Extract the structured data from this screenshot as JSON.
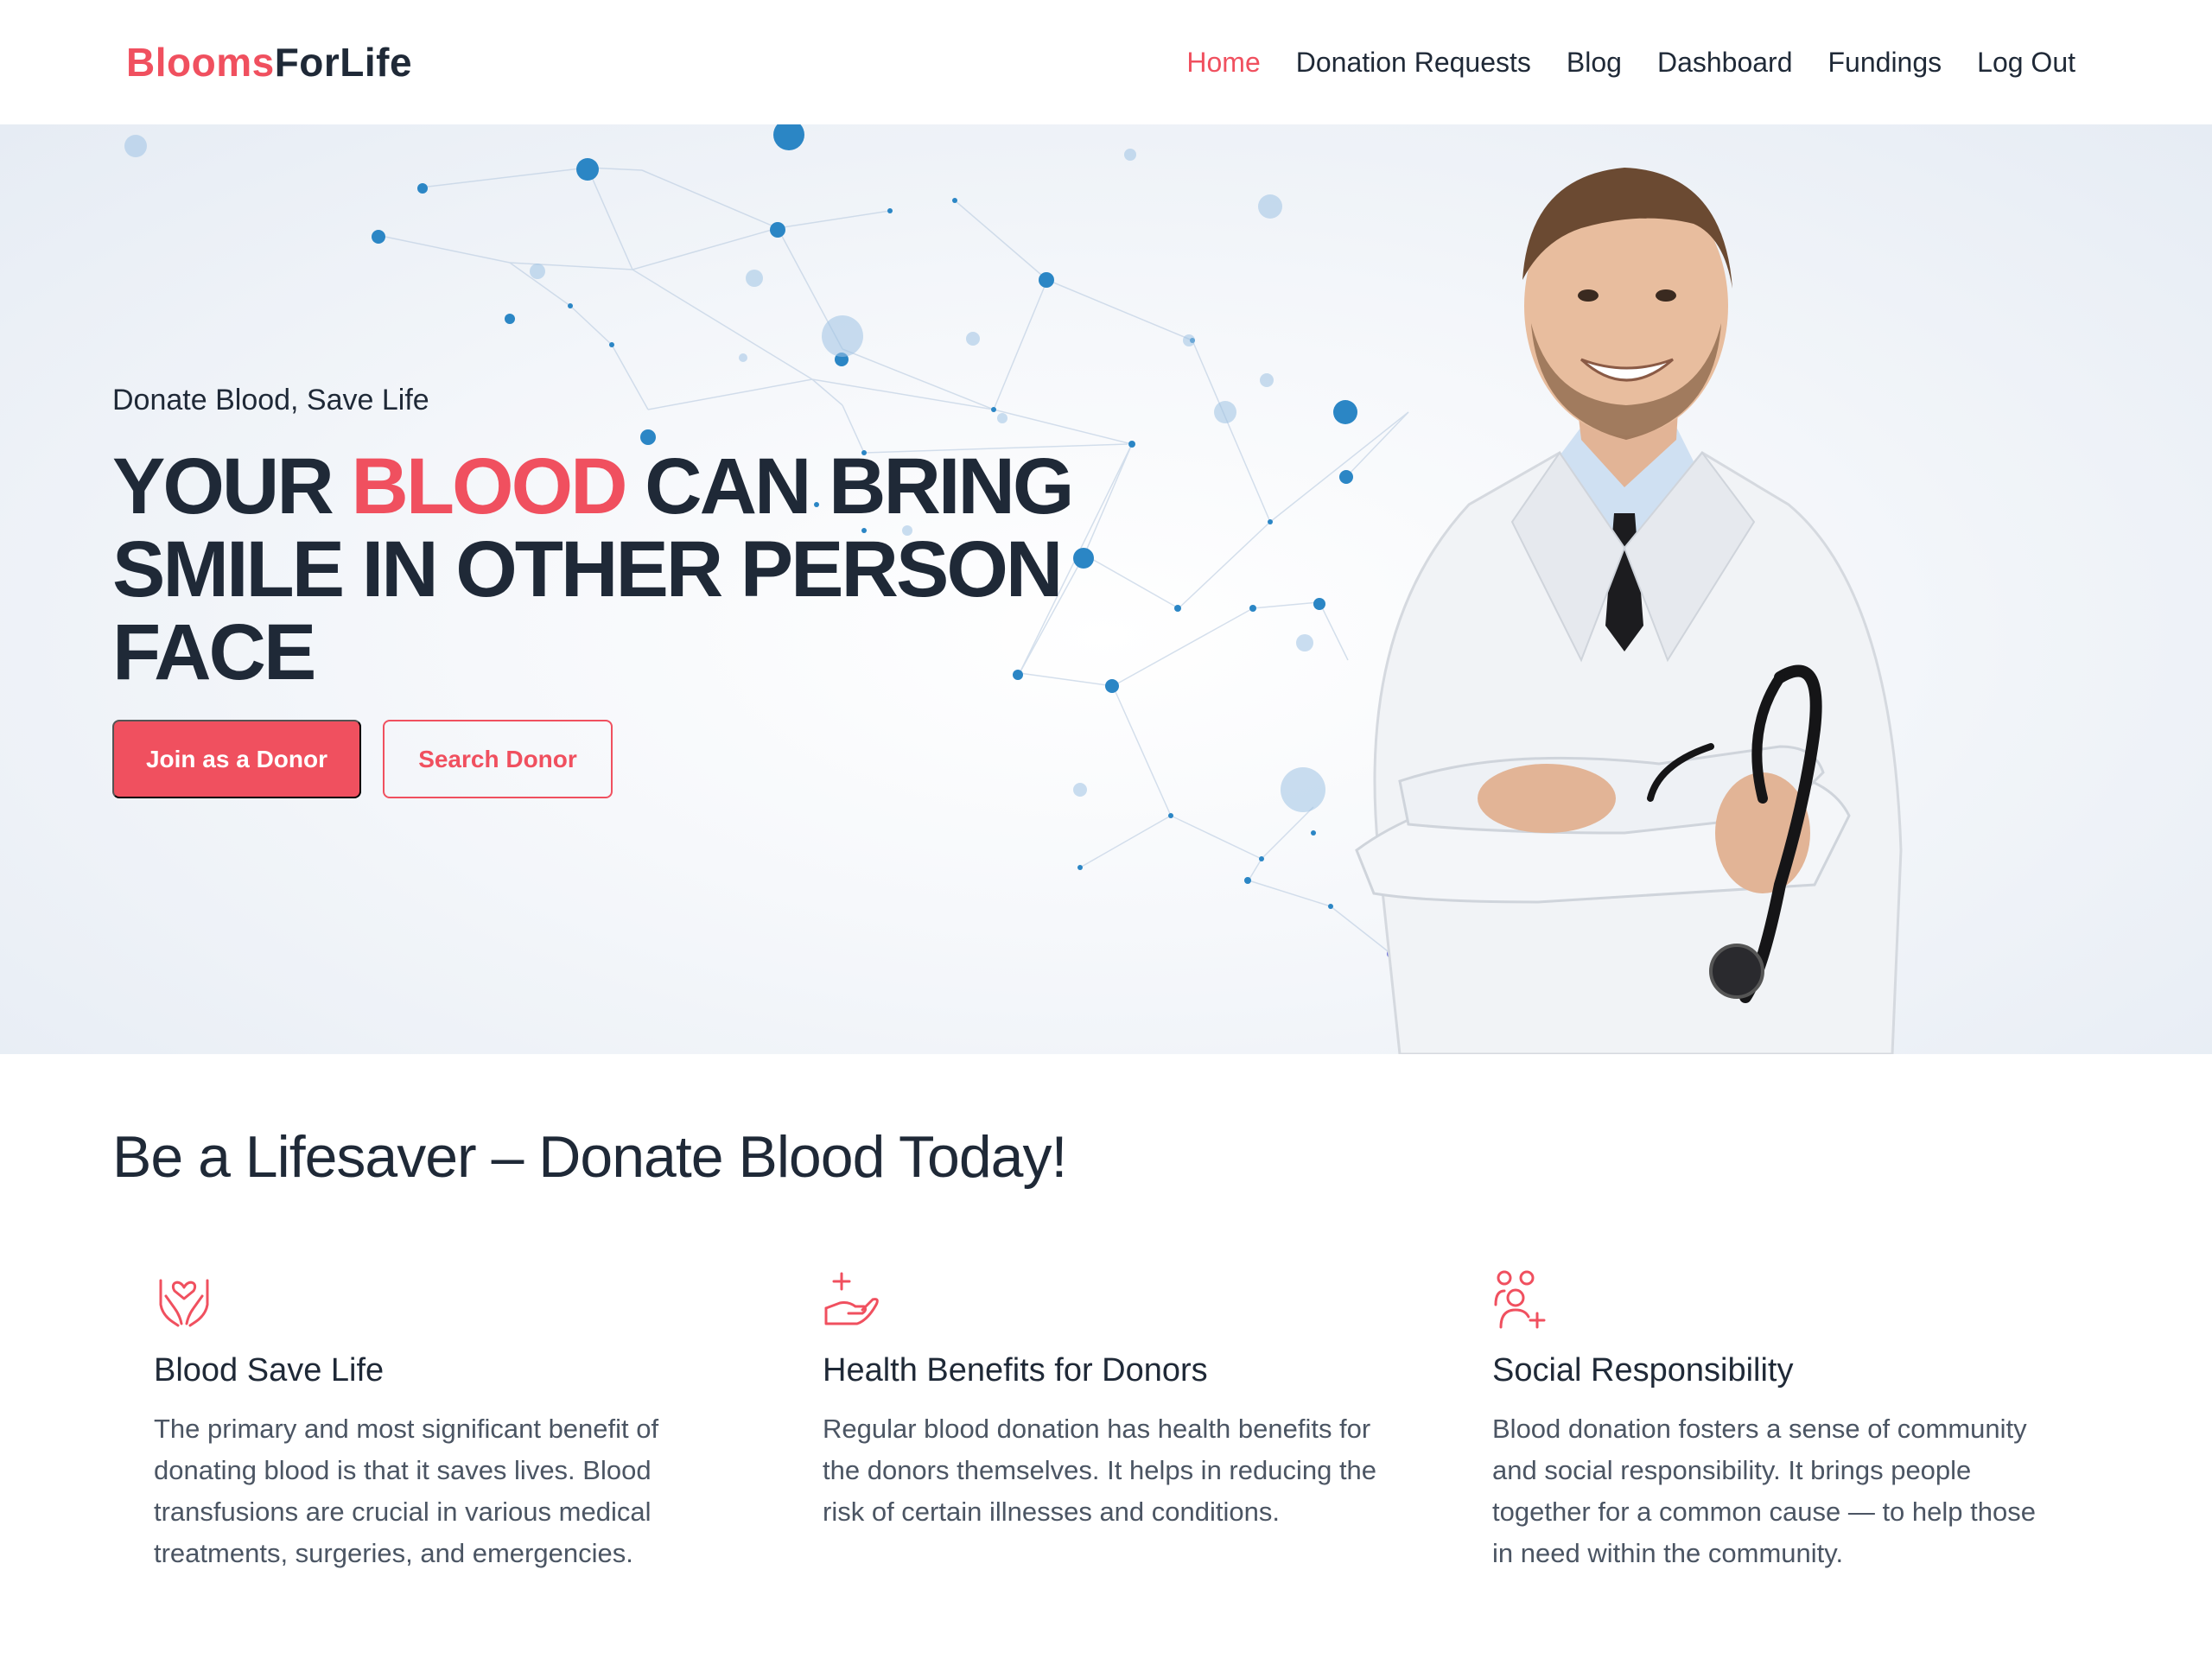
{
  "brand": {
    "part1": "Blooms",
    "part2": "ForLife"
  },
  "nav": {
    "items": [
      {
        "label": "Home",
        "active": true
      },
      {
        "label": "Donation Requests",
        "active": false
      },
      {
        "label": "Blog",
        "active": false
      },
      {
        "label": "Dashboard",
        "active": false
      },
      {
        "label": "Fundings",
        "active": false
      },
      {
        "label": "Log Out",
        "active": false
      }
    ]
  },
  "hero": {
    "eyebrow": "Donate Blood, Save Life",
    "title_part1": "YOUR ",
    "title_accent": "BLOOD",
    "title_part2": " CAN BRING SMILE IN OTHER PERSON FACE",
    "primary_button": "Join as a Donor",
    "secondary_button": "Search Donor"
  },
  "section": {
    "title": "Be a Lifesaver – Donate Blood Today!",
    "features": [
      {
        "icon": "heart-hands-icon",
        "title": "Blood Save Life",
        "text": "The primary and most significant benefit of donating blood is that it saves lives. Blood transfusions are crucial in various medical treatments, surgeries, and emergencies."
      },
      {
        "icon": "hand-plus-icon",
        "title": "Health Benefits for Donors",
        "text": "Regular blood donation has health benefits for the donors themselves. It helps in reducing the risk of certain illnesses and conditions."
      },
      {
        "icon": "people-plus-icon",
        "title": "Social Responsibility",
        "text": "Blood donation fosters a sense of community and social responsibility. It brings people together for a common cause — to help those in need within the community."
      }
    ]
  },
  "colors": {
    "accent": "#f0505f",
    "text": "#1f2937",
    "muted": "#4b5563"
  }
}
